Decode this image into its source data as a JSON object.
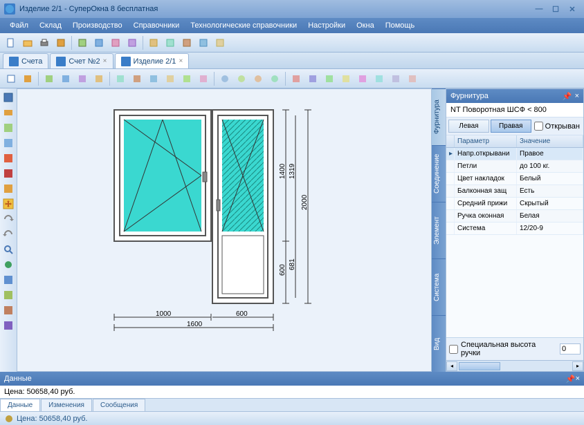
{
  "window": {
    "title": "Изделие 2/1 - СуперОкна 8 бесплатная"
  },
  "menu": [
    "Файл",
    "Склад",
    "Производство",
    "Справочники",
    "Технологические справочники",
    "Настройки",
    "Окна",
    "Помощь"
  ],
  "tabs": [
    {
      "label": "Счета",
      "active": false
    },
    {
      "label": "Счет №2",
      "active": false
    },
    {
      "label": "Изделие 2/1",
      "active": true
    }
  ],
  "drawing": {
    "dims": {
      "bottom1": "1000",
      "bottom2": "600",
      "bottom_total": "1600",
      "right1": "1400",
      "right2": "1319",
      "right3": "2000",
      "right4": "600",
      "right5": "681"
    }
  },
  "props": {
    "title": "Фурнитура",
    "profile": "NT Поворотная ШСФ < 800",
    "side_left": "Левая",
    "side_right": "Правая",
    "opening_chk": "Открыван",
    "headers": {
      "param": "Параметр",
      "value": "Значение"
    },
    "rows": [
      {
        "p": "Напр.открывани",
        "v": "Правое",
        "sel": true
      },
      {
        "p": "Петли",
        "v": "до 100 кг."
      },
      {
        "p": "Цвет накладок",
        "v": "Белый"
      },
      {
        "p": "Балконная защ",
        "v": "Есть"
      },
      {
        "p": "Средний прижи",
        "v": "Скрытый"
      },
      {
        "p": "Ручка оконная",
        "v": "Белая"
      },
      {
        "p": "Система",
        "v": "12/20-9"
      }
    ],
    "special": "Специальная высота ручки",
    "special_val": "0",
    "vtabs": [
      "Фурнитура",
      "Соединение",
      "Элемент",
      "Система",
      "Вид"
    ]
  },
  "bottom": {
    "title": "Данные",
    "price": "Цена: 50658,40 руб.",
    "tabs": [
      "Данные",
      "Изменения",
      "Сообщения"
    ]
  },
  "status": "Цена: 50658,40 руб."
}
